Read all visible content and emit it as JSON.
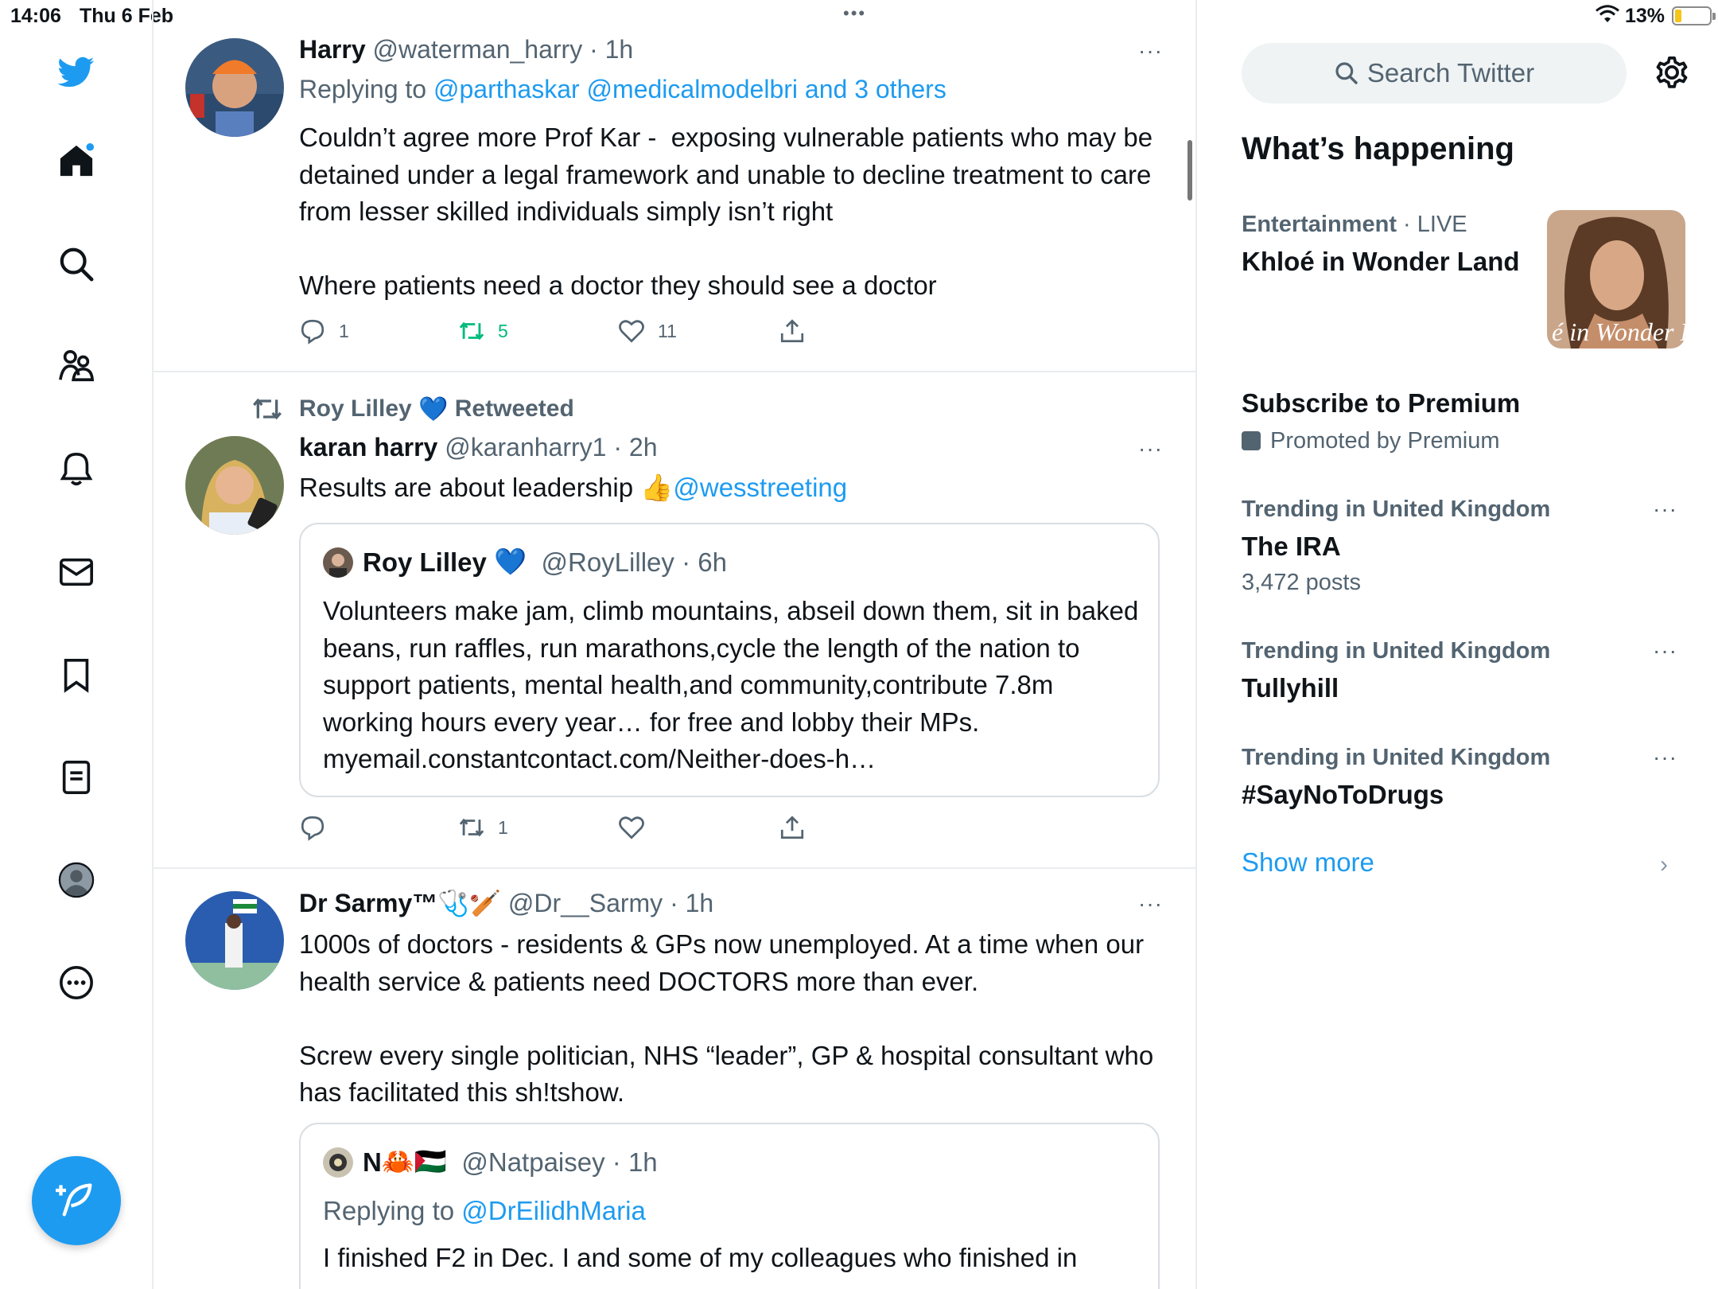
{
  "status_bar": {
    "time": "14:06",
    "date": "Thu 6 Feb",
    "battery": "13%",
    "battery_level": 0.13,
    "top_dots": "•••"
  },
  "icons": {
    "nav": [
      "twitter-logo-icon",
      "home-icon",
      "search-icon",
      "communities-icon",
      "notifications-icon",
      "messages-icon",
      "bookmarks-icon",
      "lists-icon",
      "profile-icon",
      "more-icon"
    ],
    "compose": "compose-icon",
    "actions": [
      "reply-icon",
      "retweet-icon",
      "like-icon",
      "share-icon"
    ]
  },
  "colors": {
    "accent": "#1d9bf0",
    "retweet_green": "#00ba7c",
    "muted": "#536471",
    "text": "#0f1419",
    "divider": "#e9ecef"
  },
  "timeline": {
    "tweets": [
      {
        "name": "Harry",
        "handle": "@waterman_harry",
        "time": "· 1h",
        "replying_prefix": "Replying to",
        "replying_to": "@parthaskar @medicalmodelbri and 3 others",
        "text": "Couldn’t agree more Prof Kar -  exposing vulnerable patients who may be detained under a legal framework and unable to decline treatment to care from lesser skilled individuals simply isn’t right\n\nWhere patients need a doctor they should see a doctor",
        "more": "···",
        "replies": "1",
        "retweets": "5",
        "likes": "11"
      },
      {
        "retweeted_by": "Roy Lilley",
        "retweeted_heart": "💙",
        "retweeted_label": "Retweeted",
        "name": "karan harry",
        "handle": "@karanharry1",
        "time": "· 2h",
        "text_prefix": "Results are about leadership 👍",
        "text_link": "@wesstreeting",
        "more": "···",
        "quote": {
          "name": "Roy Lilley",
          "emoji": "💙",
          "handle": "@RoyLilley",
          "time": "· 6h",
          "text": "Volunteers make jam, climb mountains, abseil down them, sit in baked beans, run raffles, run marathons,cycle the length of the nation to support patients, mental health,and community,contribute 7.8m working hours every year… for free and lobby their MPs. myemail.constantcontact.com/Neither-does-h…"
        },
        "replies": "",
        "retweets": "1",
        "likes": ""
      },
      {
        "name": "Dr Sarmy™",
        "name_emoji": "🩺🏏",
        "handle": "@Dr__Sarmy",
        "time": "· 1h",
        "text": "1000s of doctors - residents & GPs now unemployed. At a time when our health service & patients need DOCTORS more than ever.\n\nScrew every single politician, NHS “leader”, GP & hospital consultant who has facilitated this sh!tshow.",
        "more": "···",
        "quote": {
          "name": "N",
          "emoji": "🦀🇵🇸",
          "handle": "@Natpaisey",
          "time": "· 1h",
          "replying_prefix": "Replying to",
          "replying_to": "@DrEilidhMaria",
          "text": "I finished F2 in Dec. I and some of my colleagues who finished in"
        }
      }
    ]
  },
  "sidebar": {
    "search_placeholder": "Search Twitter",
    "heading": "What’s happening",
    "trends": [
      {
        "category": "Entertainment",
        "live": "· LIVE",
        "title": "Khloé in Wonder Land",
        "thumb_text": "é in Wonder L"
      },
      {
        "title": "Subscribe to Premium",
        "promoted": "Promoted by Premium"
      },
      {
        "category": "Trending in United Kingdom",
        "title": "The IRA",
        "count": "3,472 posts"
      },
      {
        "category": "Trending in United Kingdom",
        "title": "Tullyhill"
      },
      {
        "category": "Trending in United Kingdom",
        "title": "#SayNoToDrugs"
      }
    ],
    "more": "···",
    "show_more": "Show more",
    "chevron": "›"
  }
}
